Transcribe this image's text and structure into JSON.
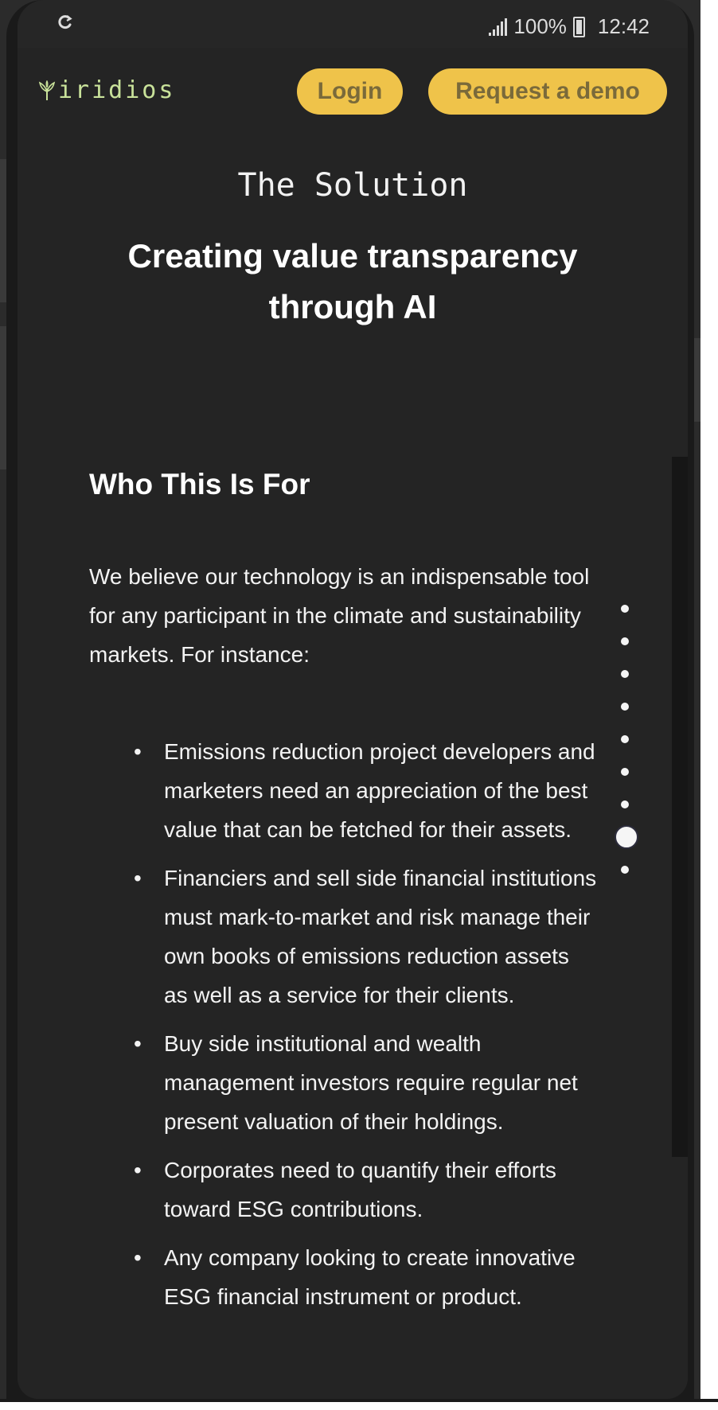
{
  "status_bar": {
    "battery_percent": "100%",
    "time": "12:42"
  },
  "nav": {
    "logo_text": "iridios",
    "login_label": "Login",
    "demo_label": "Request a demo"
  },
  "hero": {
    "eyebrow": "The Solution",
    "headline": "Creating value transparency through AI"
  },
  "section": {
    "title": "Who This Is For",
    "intro": "We believe our technology is an indispensable tool for any participant in the climate and sustainability markets. For instance:",
    "bullets": [
      "Emissions reduction project developers and marketers need an appreciation of the best value that can be fetched for their assets.",
      "Financiers and sell side financial institutions must mark-to-market and risk manage their own books of emissions reduction assets as well as a service for their clients.",
      "Buy side institutional and wealth management investors require regular net present valuation of their holdings.",
      "Corporates need to quantify their efforts toward ESG contributions.",
      "Any company looking to create innovative ESG financial instrument or product."
    ]
  },
  "section_dots": {
    "count": 9,
    "active_index": 7
  },
  "colors": {
    "background": "#242424",
    "button": "#efc34a",
    "button_text": "#7a6a3a",
    "logo": "#c9e29a"
  }
}
